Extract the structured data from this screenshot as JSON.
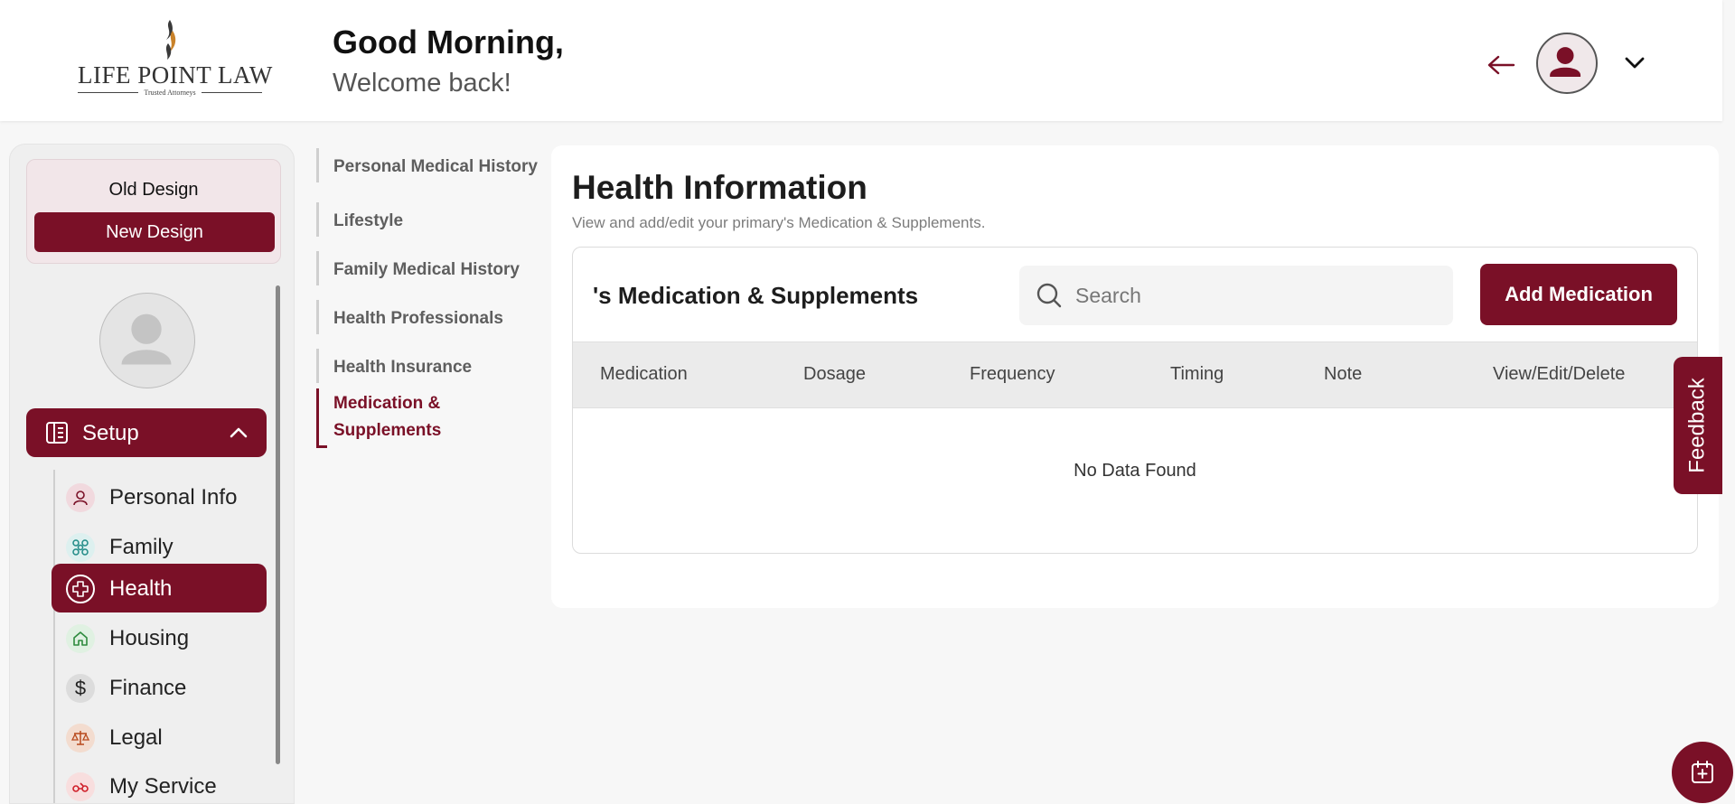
{
  "header": {
    "logo_text": "LIFE POINT LAW",
    "logo_tagline": "Trusted Attorneys",
    "greeting": "Good Morning,",
    "welcome": "Welcome back!"
  },
  "sidebar": {
    "old_design_label": "Old Design",
    "new_design_label": "New Design",
    "setup_label": "Setup",
    "items": [
      {
        "label": "Personal Info",
        "icon": "person-icon"
      },
      {
        "label": "Family",
        "icon": "family-icon"
      },
      {
        "label": "Health",
        "icon": "health-cross-icon",
        "active": true
      },
      {
        "label": "Housing",
        "icon": "house-icon"
      },
      {
        "label": "Finance",
        "icon": "dollar-icon"
      },
      {
        "label": "Legal",
        "icon": "scales-icon"
      },
      {
        "label": "My Service",
        "icon": "service-icon"
      }
    ]
  },
  "subnav": {
    "items": [
      {
        "label": "Personal Medical History"
      },
      {
        "label": "Lifestyle"
      },
      {
        "label": "Family Medical History"
      },
      {
        "label": "Health Professionals"
      },
      {
        "label": "Health Insurance"
      },
      {
        "label": "Medication &",
        "label2": "Supplements",
        "active": true
      }
    ]
  },
  "main": {
    "title": "Health Information",
    "subtitle": "View and add/edit your primary's Medication & Supplements.",
    "table_title": "'s Medication & Supplements",
    "search_placeholder": "Search",
    "add_button": "Add Medication",
    "columns": [
      "Medication",
      "Dosage",
      "Frequency",
      "Timing",
      "Note",
      "View/Edit/Delete"
    ],
    "empty_text": "No Data Found"
  },
  "feedback_label": "Feedback",
  "colors": {
    "brand": "#7a1027",
    "background": "#f7f7f7"
  }
}
